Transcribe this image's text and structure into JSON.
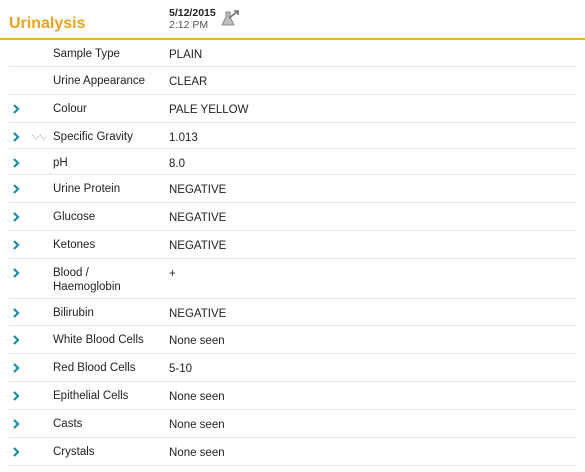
{
  "header": {
    "title": "Urinalysis",
    "date": "5/12/2015",
    "time": "2:12 PM",
    "chart_icon": "flask-chart-icon"
  },
  "colors": {
    "accent": "#eba21a",
    "chevron": "#1a8fa3",
    "divider": "#e7e7e7"
  },
  "rows": [
    {
      "label": "Sample Type",
      "value": "PLAIN",
      "expandable": false
    },
    {
      "label": "Urine Appearance",
      "value": "CLEAR",
      "expandable": false
    },
    {
      "label": "Colour",
      "value": "PALE YELLOW",
      "expandable": true
    },
    {
      "label": "Specific Gravity",
      "value": "1.013",
      "expandable": true,
      "trend_icon": true
    },
    {
      "label": "pH",
      "value": "8.0",
      "expandable": true
    },
    {
      "label": "Urine Protein",
      "value": "NEGATIVE",
      "expandable": true
    },
    {
      "label": "Glucose",
      "value": "NEGATIVE",
      "expandable": true
    },
    {
      "label": "Ketones",
      "value": "NEGATIVE",
      "expandable": true
    },
    {
      "label": "Blood / Haemoglobin",
      "value": "+",
      "expandable": true
    },
    {
      "label": "Bilirubin",
      "value": "NEGATIVE",
      "expandable": true
    },
    {
      "label": "White Blood Cells",
      "value": "None seen",
      "expandable": true
    },
    {
      "label": "Red Blood Cells",
      "value": "5-10",
      "expandable": true
    },
    {
      "label": "Epithelial Cells",
      "value": "None seen",
      "expandable": true
    },
    {
      "label": "Casts",
      "value": "None seen",
      "expandable": true
    },
    {
      "label": "Crystals",
      "value": "None seen",
      "expandable": true
    }
  ]
}
